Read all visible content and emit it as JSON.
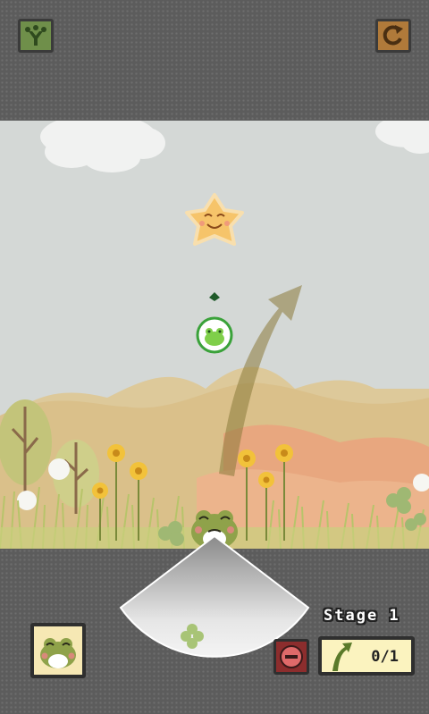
{
  "hud": {
    "stage_label": "Stage 1",
    "counter": "0/1"
  },
  "buttons": {
    "menu_icon": "frog-hand-icon",
    "retry_icon": "retry-icon",
    "stop_icon": "no-entry-icon",
    "counter_icon": "jump-arrow-icon"
  },
  "colors": {
    "frame": "#5c5c5c",
    "sky": "#d4d8d6",
    "menu_button": "#6f8f4a",
    "retry_button": "#b07a3a",
    "stop_button": "#8c2d2d",
    "counter_bg": "#fbf3bf",
    "star": "#f6c46a",
    "frog": "#8fa24a"
  }
}
